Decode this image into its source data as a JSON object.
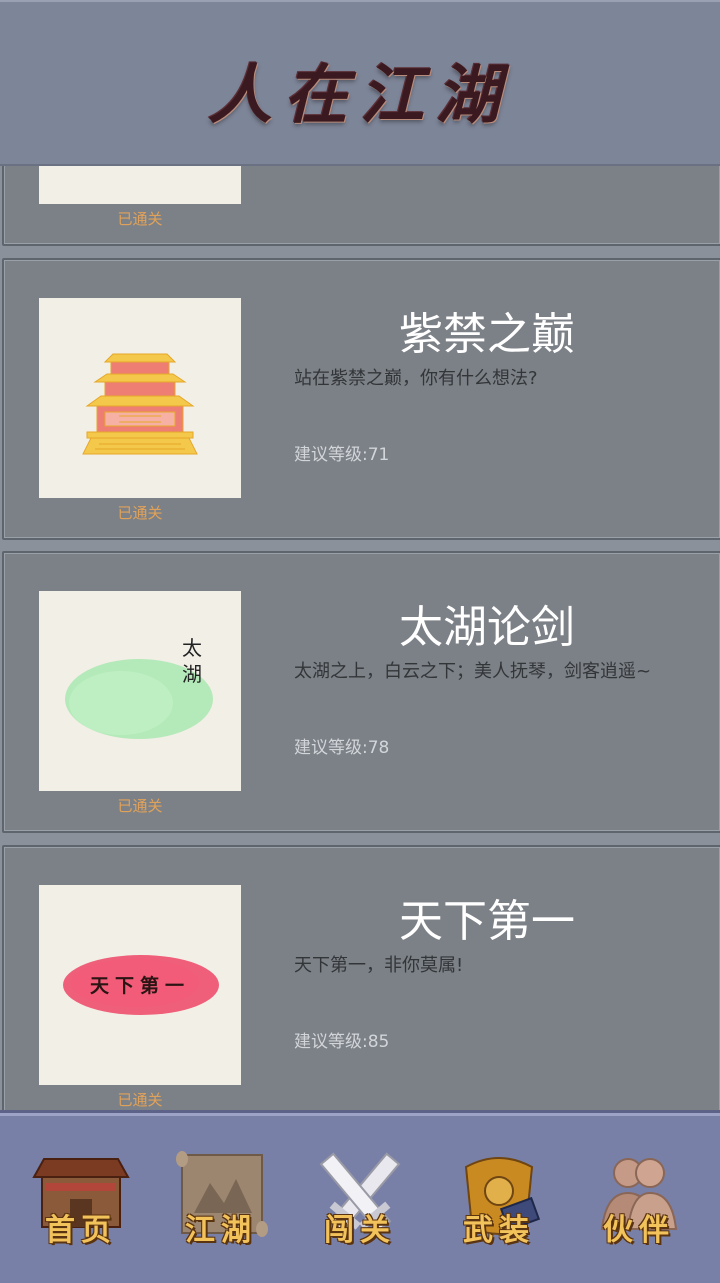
{
  "app": {
    "title": "人在江湖"
  },
  "levels": [
    {
      "name": "",
      "desc": "",
      "level": "",
      "status": "已通关"
    },
    {
      "name": "紫禁之巅",
      "desc": "站在紫禁之巅，你有什么想法?",
      "level": "建议等级:71",
      "status": "已通关"
    },
    {
      "name": "太湖论剑",
      "desc": "太湖之上，白云之下；美人抚琴，剑客逍遥~",
      "level": "建议等级:78",
      "status": "已通关",
      "thumb_text": "太湖"
    },
    {
      "name": "天下第一",
      "desc": "天下第一，非你莫属!",
      "level": "建议等级:85",
      "status": "已通关",
      "thumb_text": "天下第一"
    }
  ],
  "nav": [
    {
      "label": "首页",
      "icon": "house-icon"
    },
    {
      "label": "江湖",
      "icon": "scroll-map-icon"
    },
    {
      "label": "闯关",
      "icon": "crossed-swords-icon"
    },
    {
      "label": "武装",
      "icon": "armor-icon"
    },
    {
      "label": "伙伴",
      "icon": "companions-icon"
    }
  ],
  "colors": {
    "header": "#7d8598",
    "card": "#7c8187",
    "nav": "#7880a8",
    "cleared": "#e0a25a",
    "nav_label": "#f2c25b"
  }
}
